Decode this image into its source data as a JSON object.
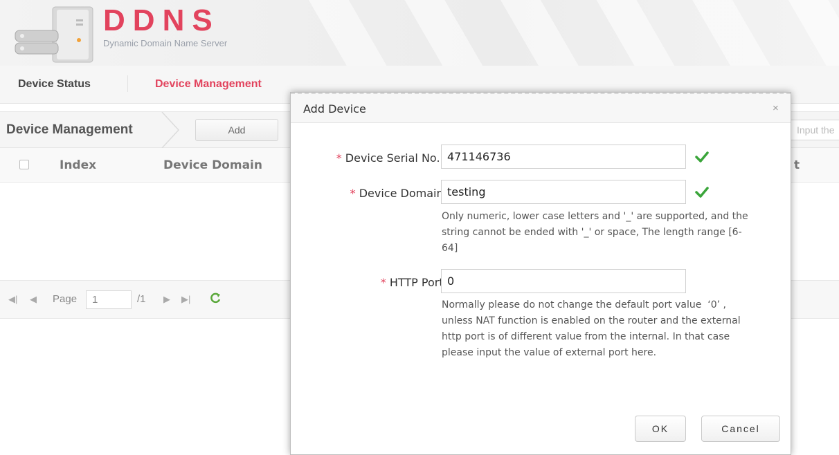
{
  "header": {
    "logo_letters": [
      "D",
      "D",
      "N",
      "S"
    ],
    "logo_colors": [
      "#e2435d",
      "#e2435d",
      "#e2435d",
      "#e2435d"
    ],
    "subtitle": "Dynamic Domain Name Server"
  },
  "nav": {
    "items": [
      {
        "label": "Device Status",
        "active": false
      },
      {
        "label": "Device Management",
        "active": true
      }
    ]
  },
  "toolbar": {
    "title": "Device Management",
    "add_label": "Add",
    "search_placeholder": "Input the"
  },
  "table": {
    "columns": [
      "Index",
      "Device Domain"
    ],
    "partial_column_fragment": "t"
  },
  "pager": {
    "page_label": "Page",
    "page_value": "1",
    "total_label": "/1"
  },
  "dialog": {
    "title": "Add Device",
    "close_symbol": "×",
    "required_marker": "*",
    "fields": {
      "serial": {
        "label": "Device Serial No. :",
        "value": "471146736",
        "valid": true
      },
      "domain": {
        "label": "Device Domain:",
        "value": "testing",
        "valid": true
      },
      "port": {
        "label": "HTTP Port:",
        "value": "0"
      }
    },
    "hints": {
      "domain": "Only numeric, lower case letters and '_' are supported, and the string cannot be ended with '_' or space, The length range [6-64]",
      "port": "Normally please do not change the default port value  ‘0’ , unless NAT function is enabled on the router and the external http port is of different value from the internal. In that case please input the value of external port here."
    },
    "ok_label": "OK",
    "cancel_label": "Cancel"
  },
  "colors": {
    "accent": "#e2435d",
    "check_green": "#3aa53a"
  },
  "icons": [
    "server-icon",
    "first-page-icon",
    "prev-page-icon",
    "next-page-icon",
    "last-page-icon",
    "refresh-icon",
    "close-icon",
    "check-icon"
  ]
}
